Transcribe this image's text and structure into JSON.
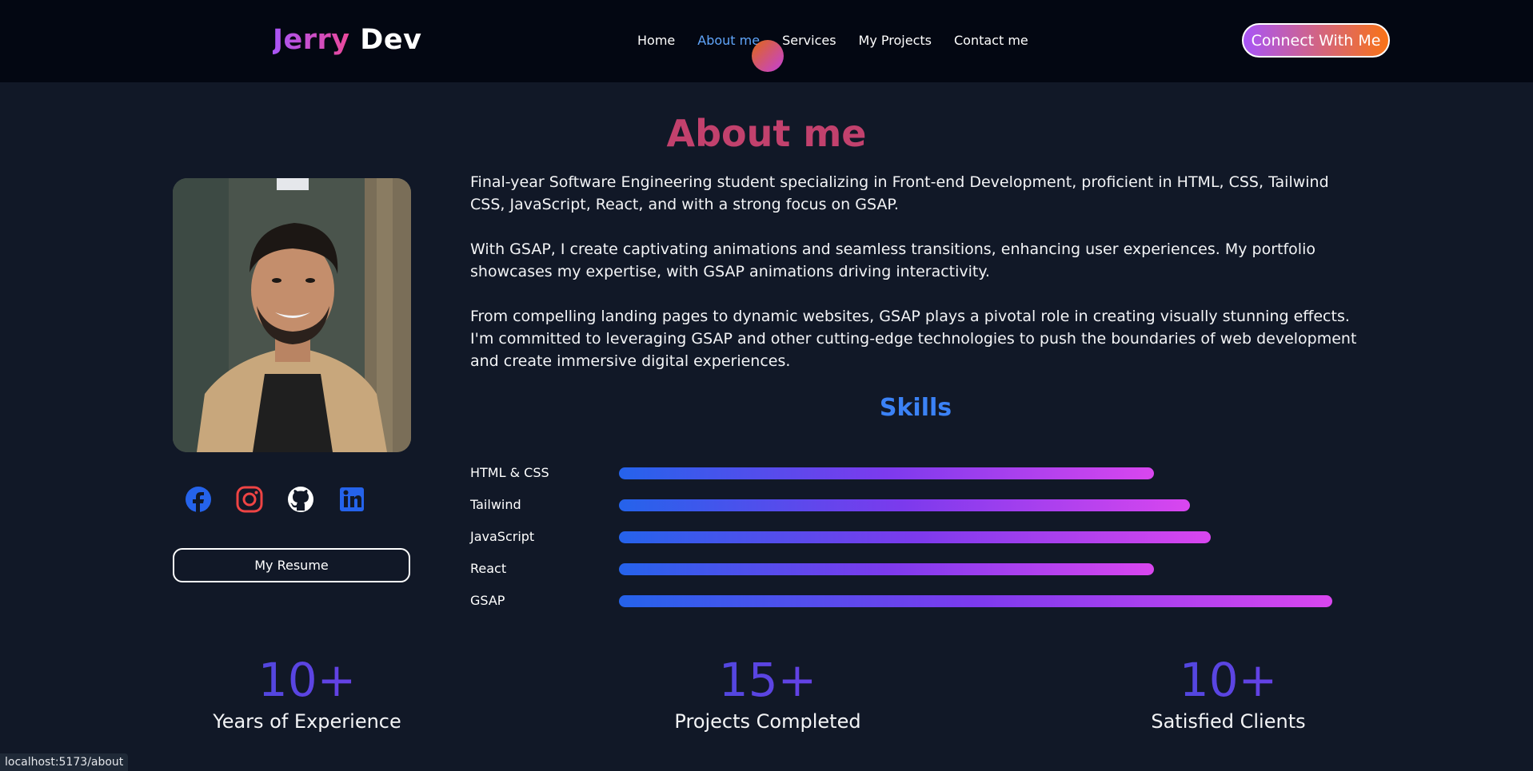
{
  "header": {
    "logo_first": "Jerry",
    "logo_second": "Dev",
    "nav": [
      {
        "label": "Home"
      },
      {
        "label": "About me",
        "active": true
      },
      {
        "label": "Services"
      },
      {
        "label": "My Projects"
      },
      {
        "label": "Contact me"
      }
    ],
    "connect_label": "Connect With Me"
  },
  "main": {
    "title": "About me",
    "bio": [
      "Final-year Software Engineering student specializing in Front-end Development, proficient in HTML, CSS, Tailwind CSS, JavaScript, React, and with a strong focus on GSAP.",
      "With GSAP, I create captivating animations and seamless transitions, enhancing user experiences. My portfolio showcases my expertise, with GSAP animations driving interactivity.",
      "From compelling landing pages to dynamic websites, GSAP plays a pivotal role in creating visually stunning effects. I'm committed to leveraging GSAP and other cutting-edge technologies to push the boundaries of web development and create immersive digital experiences."
    ],
    "socials": [
      {
        "icon": "facebook-icon",
        "color": "#2563eb"
      },
      {
        "icon": "instagram-icon",
        "color": "#ef4444"
      },
      {
        "icon": "github-icon",
        "color": "#ffffff"
      },
      {
        "icon": "linkedin-icon",
        "color": "#2563eb"
      }
    ],
    "resume_label": "My Resume",
    "skills_title": "Skills",
    "skills": [
      {
        "name": "HTML & CSS",
        "level": 0.75
      },
      {
        "name": "Tailwind",
        "level": 0.8
      },
      {
        "name": "JavaScript",
        "level": 0.83
      },
      {
        "name": "React",
        "level": 0.75
      },
      {
        "name": "GSAP",
        "level": 1.0
      }
    ],
    "stats": [
      {
        "value": "10+",
        "label": "Years of Experience"
      },
      {
        "value": "15+",
        "label": "Projects Completed"
      },
      {
        "value": "10+",
        "label": "Satisfied Clients"
      }
    ]
  },
  "status_bar": {
    "url": "localhost:5173/about"
  }
}
